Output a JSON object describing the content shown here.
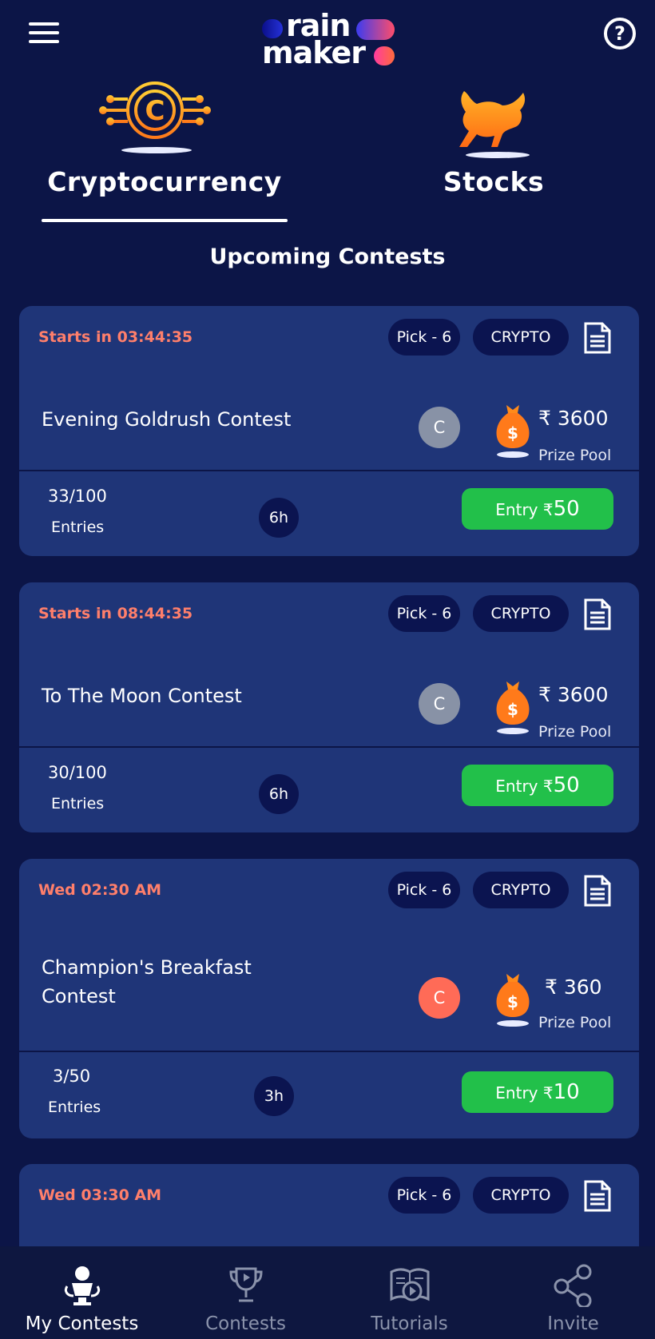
{
  "header": {
    "logo_line1": "rain",
    "logo_line2": "maker",
    "help_glyph": "?"
  },
  "categories": [
    {
      "label": "Cryptocurrency",
      "icon": "crypto-coin-circuit-icon",
      "active": true
    },
    {
      "label": "Stocks",
      "icon": "bull-icon",
      "active": false
    }
  ],
  "section_title": "Upcoming Contests",
  "contests": [
    {
      "start": "Starts in 03:44:35",
      "pick": "Pick - 6",
      "type": "CRYPTO",
      "name": "Evening Goldrush Contest",
      "currency_badge": "C",
      "badge_color": "#8892a6",
      "prize": "₹ 3600",
      "prize_label": "Prize Pool",
      "entries": "33/100",
      "entries_label": "Entries",
      "duration": "6h",
      "entry_prefix": "Entry ₹",
      "entry_amount": "50"
    },
    {
      "start": "Starts in 08:44:35",
      "pick": "Pick - 6",
      "type": "CRYPTO",
      "name": "To The Moon Contest",
      "currency_badge": "C",
      "badge_color": "#8892a6",
      "prize": "₹ 3600",
      "prize_label": "Prize Pool",
      "entries": "30/100",
      "entries_label": "Entries",
      "duration": "6h",
      "entry_prefix": "Entry ₹",
      "entry_amount": "50"
    },
    {
      "start": "Wed 02:30 AM",
      "pick": "Pick - 6",
      "type": "CRYPTO",
      "name": "Champion's Breakfast Contest",
      "currency_badge": "C",
      "badge_color": "#ff6b57",
      "prize": "₹ 360",
      "prize_label": "Prize Pool",
      "entries": "3/50",
      "entries_label": "Entries",
      "duration": "3h",
      "entry_prefix": "Entry ₹",
      "entry_amount": "10"
    },
    {
      "start": "Wed 03:30 AM",
      "pick": "Pick - 6",
      "type": "CRYPTO"
    }
  ],
  "bottom_nav": [
    {
      "label": "My Contests",
      "icon": "trophy-person-icon",
      "active": true
    },
    {
      "label": "Contests",
      "icon": "trophy-icon",
      "active": false
    },
    {
      "label": "Tutorials",
      "icon": "book-play-icon",
      "active": false
    },
    {
      "label": "Invite",
      "icon": "share-icon",
      "active": false
    }
  ],
  "colors": {
    "background": "#0c1547",
    "card": "#1f3578",
    "chip": "#0b1450",
    "entry_button": "#22c04a",
    "start_time": "#ff7f6b"
  }
}
